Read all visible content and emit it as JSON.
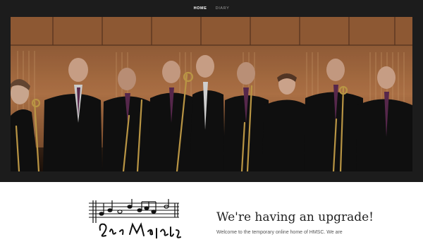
{
  "nav": {
    "items": [
      {
        "label": "HOME",
        "active": true
      },
      {
        "label": "DIARY",
        "active": false
      }
    ]
  },
  "hero": {
    "image": "ensemble-photo",
    "description_icon": "photo"
  },
  "logo": {
    "script_text": "His Majestys"
  },
  "intro": {
    "headline": "We're having an upgrade!",
    "paragraph": "Welcome to the temporary online home of HMSC. We are"
  },
  "colors": {
    "header_bg": "#1c1c1c",
    "nav_active": "#ffffff",
    "nav_inactive": "#9a9a9a",
    "text_dark": "#222222",
    "text_body": "#555555"
  }
}
